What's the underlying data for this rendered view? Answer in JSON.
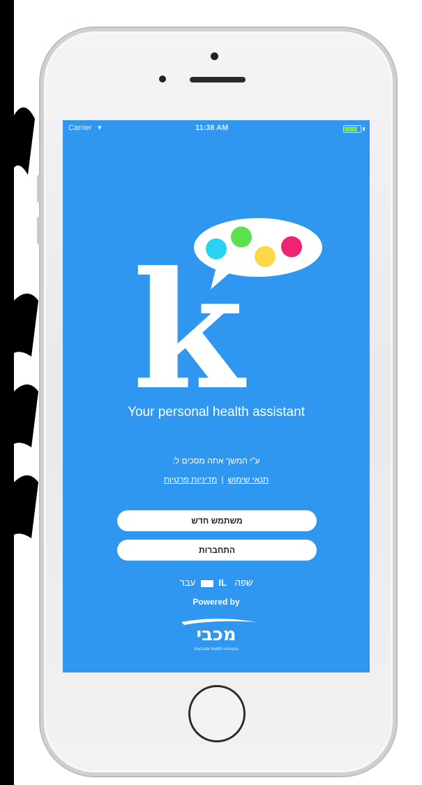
{
  "status_bar": {
    "carrier": "Carrier",
    "time": "11:38 AM"
  },
  "app": {
    "logo_letter": "k",
    "tagline": "Your personal health assistant",
    "consent_text": "ע\"י המשך אתה מסכים ל:",
    "terms_link": "תנאי שימוש",
    "privacy_link": "מדיניות פרטיות",
    "link_separator": "|",
    "register_button": "משתמש חדש",
    "login_button": "התחברות",
    "language_label": "שפה",
    "language_code": "IL",
    "language_native": "עבר",
    "powered_by": "Powered by",
    "partner_logo_text": "מכבי",
    "partner_subtitle": "maccabi health services"
  },
  "colors": {
    "screen_bg": "#2f97f0",
    "dot_cyan": "#27d3f0",
    "dot_green": "#5ce04f",
    "dot_yellow": "#ffd84a",
    "dot_pink": "#ee2470"
  }
}
